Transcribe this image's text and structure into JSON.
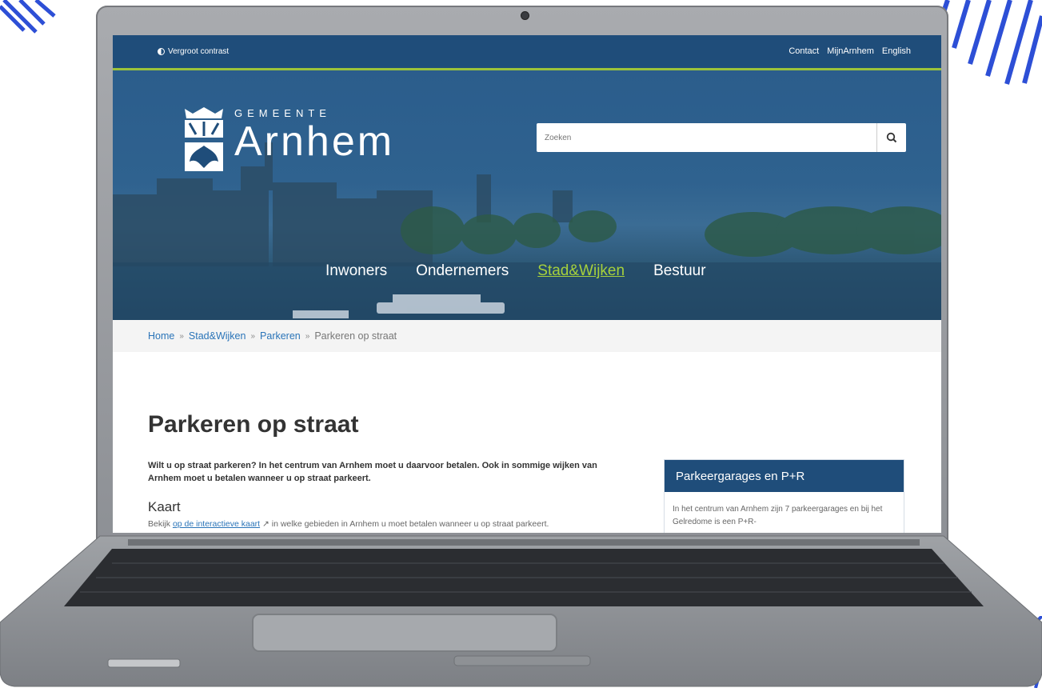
{
  "topbar": {
    "contrast_label": "Vergroot contrast",
    "links": [
      "Contact",
      "MijnArnhem",
      "English"
    ]
  },
  "logo": {
    "small": "GEMEENTE",
    "big": "Arnhem"
  },
  "search": {
    "placeholder": "Zoeken"
  },
  "nav": {
    "items": [
      "Inwoners",
      "Ondernemers",
      "Stad&Wijken",
      "Bestuur"
    ],
    "active": "Stad&Wijken"
  },
  "breadcrumb": [
    "Home",
    "Stad&Wijken",
    "Parkeren",
    "Parkeren op straat"
  ],
  "page": {
    "title": "Parkeren op straat",
    "intro": "Wilt u op straat parkeren? In het centrum van Arnhem moet u daarvoor betalen. Ook in sommige wijken van Arnhem moet u betalen wanneer u op straat parkeert.",
    "section_title": "Kaart",
    "section_text_before": "Bekijk ",
    "section_link": "op de interactieve kaart",
    "section_text_after": " in welke gebieden in Arnhem u moet betalen wanneer u op straat parkeert."
  },
  "sidebar": {
    "title": "Parkeergarages en P+R",
    "text": "In het centrum van Arnhem zijn 7 parkeergarages en bij het Gelredome is een P+R-"
  },
  "colors": {
    "brand_blue": "#1f4d7a",
    "accent_green": "#9cc33b",
    "link_blue": "#2a74b8"
  }
}
